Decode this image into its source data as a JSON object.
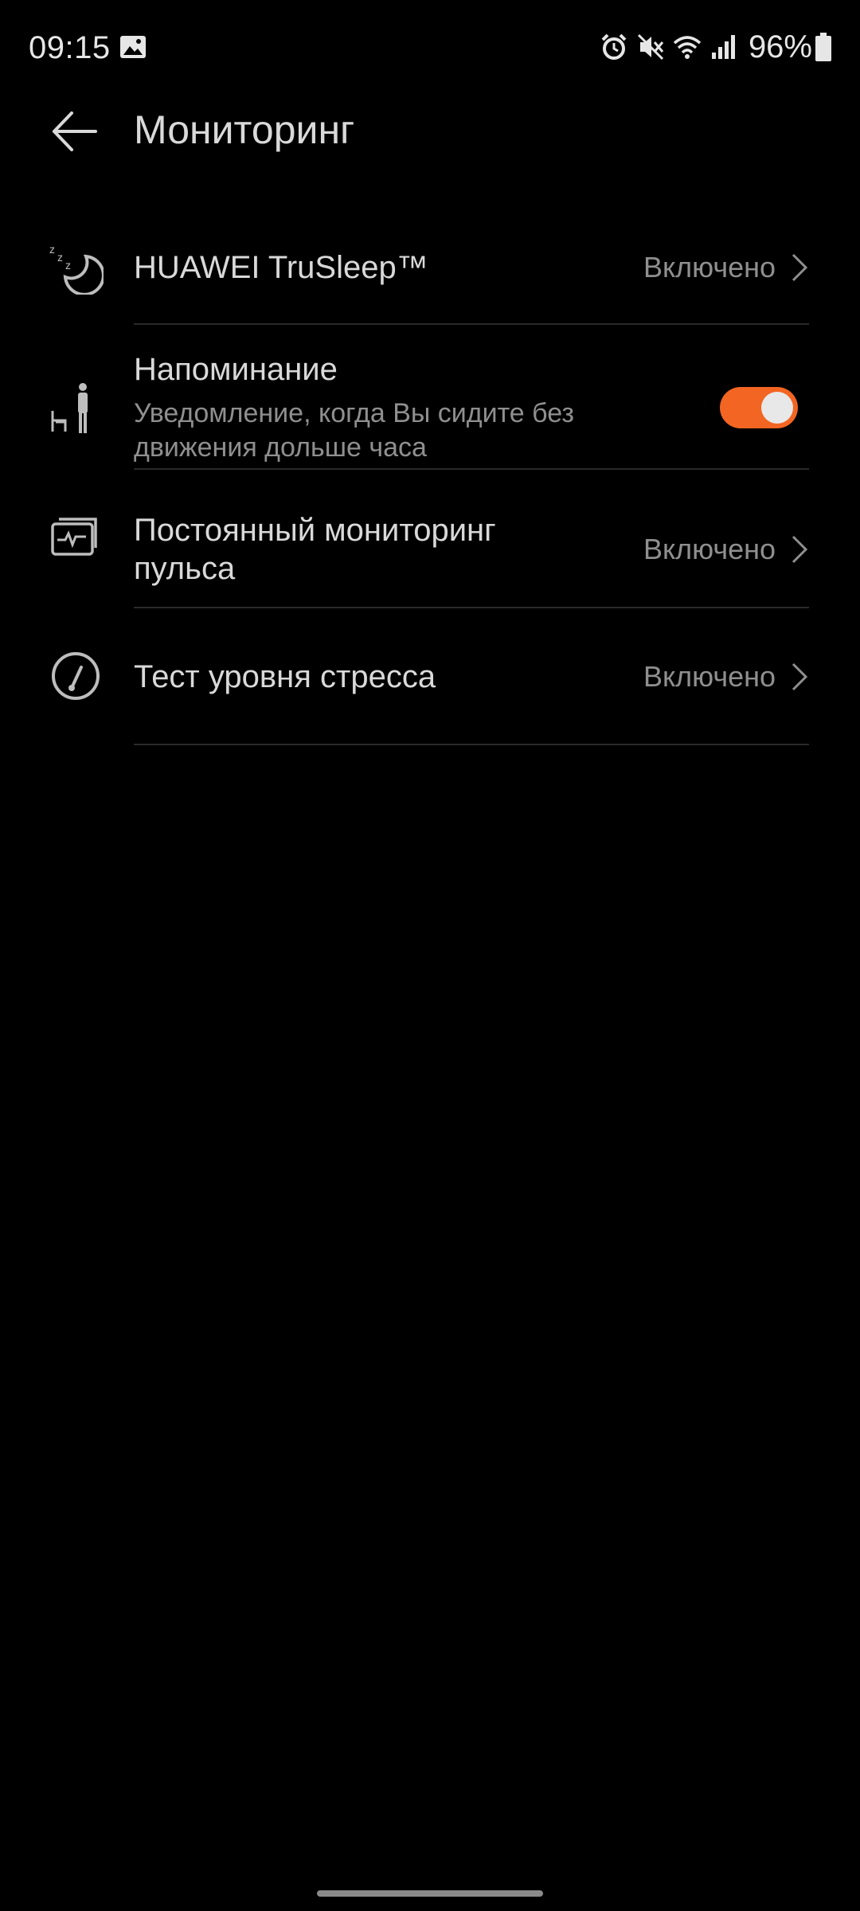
{
  "status_bar": {
    "time": "09:15",
    "battery": "96%",
    "icons": [
      "gallery-icon",
      "alarm-icon",
      "mute-icon",
      "wifi-icon",
      "signal-icon",
      "battery-icon"
    ]
  },
  "header": {
    "title": "Мониторинг",
    "back_icon": "arrow-left-icon"
  },
  "settings": [
    {
      "icon": "sleep-icon",
      "title": "HUAWEI TruSleep™",
      "status": "Включено"
    },
    {
      "icon": "sitting-person-icon",
      "title": "Напоминание",
      "subtitle_line1": "Уведомление, когда Вы сидите без",
      "subtitle_line2": "движения дольше часа",
      "toggle_on": true
    },
    {
      "icon": "heart-rate-icon",
      "title_line1": "Постоянный мониторинг",
      "title_line2": "пульса",
      "status": "Включено"
    },
    {
      "icon": "stress-gauge-icon",
      "title": "Тест уровня стресса",
      "status": "Включено"
    }
  ],
  "colors": {
    "background": "#000000",
    "accent": "#f26522",
    "text_primary": "#d9d9d9",
    "text_secondary": "#8f8f8f"
  }
}
